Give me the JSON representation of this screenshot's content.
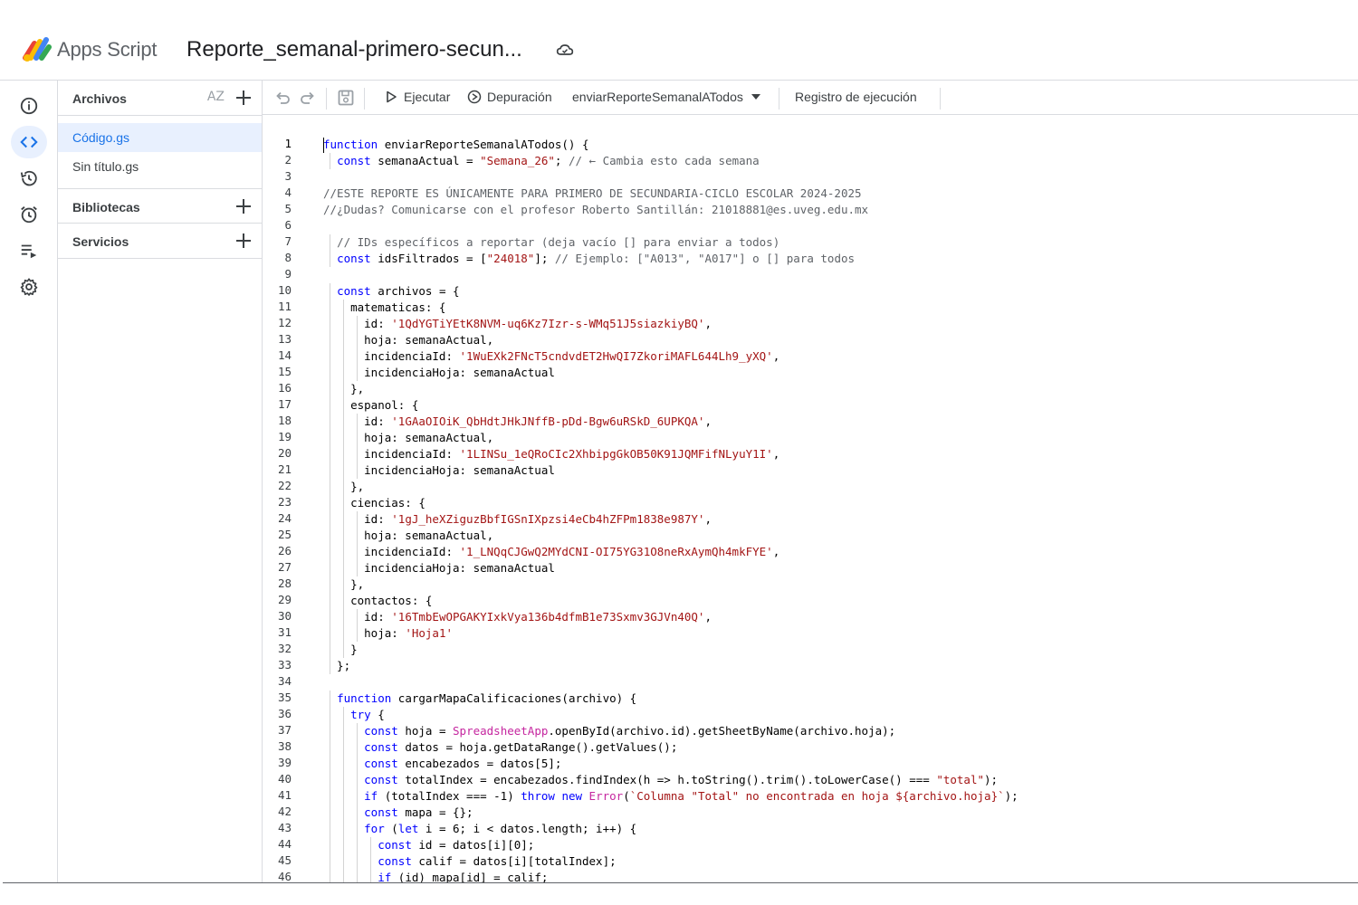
{
  "header": {
    "app_name": "Apps Script",
    "project_title": "Reporte_semanal-primero-secun..."
  },
  "files": {
    "section_label": "Archivos",
    "sort_label": "AZ",
    "items": [
      {
        "label": "Código.gs",
        "active": true
      },
      {
        "label": "Sin título.gs",
        "active": false
      }
    ],
    "libraries_label": "Bibliotecas",
    "services_label": "Servicios"
  },
  "toolbar": {
    "run_label": "Ejecutar",
    "debug_label": "Depuración",
    "function_select": "enviarReporteSemanalATodos",
    "log_label": "Registro de ejecución"
  },
  "editor": {
    "current_line": 1,
    "lines": [
      "function enviarReporteSemanalATodos() {",
      "  const semanaActual = \"Semana_26\"; // ← Cambia esto cada semana",
      "",
      "//ESTE REPORTE ES ÚNICAMENTE PARA PRIMERO DE SECUNDARIA-CICLO ESCOLAR 2024-2025",
      "//¿Dudas? Comunicarse con el profesor Roberto Santillán: 21018881@es.uveg.edu.mx",
      "",
      "  // IDs específicos a reportar (deja vacío [] para enviar a todos)",
      "  const idsFiltrados = [\"24018\"]; // Ejemplo: [\"A013\", \"A017\"] o [] para todos",
      "",
      "  const archivos = {",
      "    matematicas: {",
      "      id: '1QdYGTiYEtK8NVM-uq6Kz7Izr-s-WMq51J5siazkiyBQ',",
      "      hoja: semanaActual,",
      "      incidenciaId: '1WuEXk2FNcT5cndvdET2HwQI7ZkoriMAFL644Lh9_yXQ',",
      "      incidenciaHoja: semanaActual",
      "    },",
      "    espanol: {",
      "      id: '1GAaOIOiK_QbHdtJHkJNffB-pDd-Bgw6uRSkD_6UPKQA',",
      "      hoja: semanaActual,",
      "      incidenciaId: '1LINSu_1eQRoCIc2XhbipgGkOB50K91JQMFifNLyuY1I',",
      "      incidenciaHoja: semanaActual",
      "    },",
      "    ciencias: {",
      "      id: '1gJ_heXZiguzBbfIGSnIXpzsi4eCb4hZFPm1838e987Y',",
      "      hoja: semanaActual,",
      "      incidenciaId: '1_LNQqCJGwQ2MYdCNI-OI75YG31O8neRxAymQh4mkFYE',",
      "      incidenciaHoja: semanaActual",
      "    },",
      "    contactos: {",
      "      id: '16TmbEwOPGAKYIxkVya136b4dfmB1e73Sxmv3GJVn40Q',",
      "      hoja: 'Hoja1'",
      "    }",
      "  };",
      "",
      "  function cargarMapaCalificaciones(archivo) {",
      "    try {",
      "      const hoja = SpreadsheetApp.openById(archivo.id).getSheetByName(archivo.hoja);",
      "      const datos = hoja.getDataRange().getValues();",
      "      const encabezados = datos[5];",
      "      const totalIndex = encabezados.findIndex(h => h.toString().trim().toLowerCase() === \"total\");",
      "      if (totalIndex === -1) throw new Error(`Columna \"Total\" no encontrada en hoja ${archivo.hoja}`);",
      "      const mapa = {};",
      "      for (let i = 6; i < datos.length; i++) {",
      "        const id = datos[i][0];",
      "        const calif = datos[i][totalIndex];",
      "        if (id) mapa[id] = calif;"
    ]
  }
}
